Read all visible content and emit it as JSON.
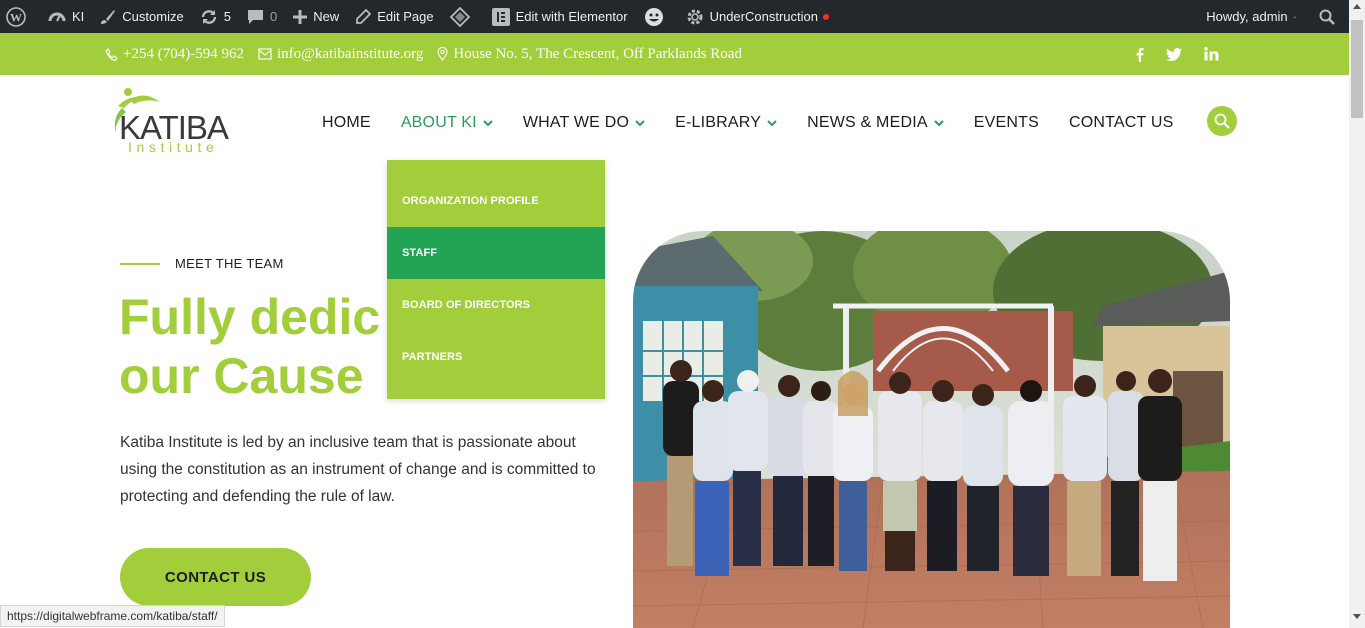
{
  "admin_bar": {
    "site_name": "KI",
    "customize": "Customize",
    "updates_count": "5",
    "comments_count": "0",
    "new_label": "New",
    "edit_page": "Edit Page",
    "elementor": "Edit with Elementor",
    "under_construction": "UnderConstruction",
    "howdy": "Howdy, admin"
  },
  "topbar": {
    "phone": "+254 (704)-594 962",
    "email": "info@katibainstitute.org",
    "address": "House No. 5, The Crescent, Off Parklands Road",
    "social": [
      "facebook-icon",
      "twitter-icon",
      "linkedin-icon"
    ]
  },
  "logo": {
    "main": "KATIBA",
    "sub": "Institute"
  },
  "nav": {
    "items": [
      {
        "label": "HOME",
        "has_dropdown": false
      },
      {
        "label": "ABOUT KI",
        "has_dropdown": true,
        "active": true
      },
      {
        "label": "WHAT WE DO",
        "has_dropdown": true
      },
      {
        "label": "E-LIBRARY",
        "has_dropdown": true
      },
      {
        "label": "NEWS & MEDIA",
        "has_dropdown": true
      },
      {
        "label": "EVENTS",
        "has_dropdown": false
      },
      {
        "label": "CONTACT US",
        "has_dropdown": false
      }
    ]
  },
  "dropdown": {
    "items": [
      "ORGANIZATION PROFILE",
      "STAFF",
      "BOARD OF DIRECTORS",
      "PARTNERS"
    ],
    "active": "STAFF"
  },
  "hero": {
    "eyebrow": "MEET THE TEAM",
    "title_line1": "Fully dedic",
    "title_line2": "our Cause",
    "text": "Katiba Institute is led by an inclusive team that is passionate about using the constitution as an instrument of change and is committed to protecting and defending the rule of law.",
    "button": "CONTACT US"
  },
  "status_url": "https://digitalwebframe.com/katiba/staff/",
  "colors": {
    "brand_green": "#a3ce3b",
    "dark_green": "#23a455",
    "admin_bar": "#23282d",
    "nav_active": "#2a9d5b"
  }
}
